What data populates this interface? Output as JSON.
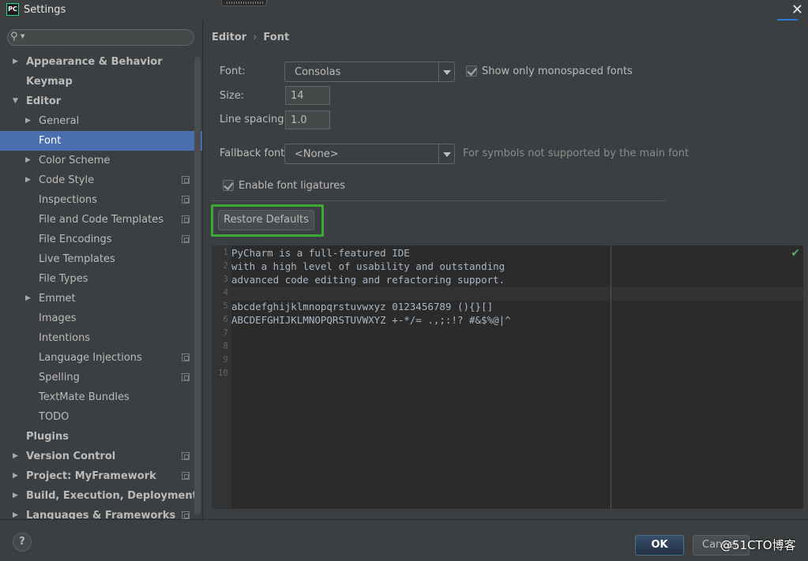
{
  "window": {
    "title": "Settings",
    "app_icon": "PC"
  },
  "search": {
    "placeholder": ""
  },
  "sidebar": {
    "items": [
      {
        "label": "Appearance & Behavior",
        "level": 0,
        "arrow": "right",
        "bold": true,
        "proj": false
      },
      {
        "label": "Keymap",
        "level": 0,
        "arrow": "",
        "bold": true,
        "proj": false
      },
      {
        "label": "Editor",
        "level": 0,
        "arrow": "down",
        "bold": true,
        "proj": false
      },
      {
        "label": "General",
        "level": 1,
        "arrow": "right",
        "bold": false,
        "proj": false
      },
      {
        "label": "Font",
        "level": 1,
        "arrow": "",
        "bold": false,
        "proj": false,
        "selected": true
      },
      {
        "label": "Color Scheme",
        "level": 1,
        "arrow": "right",
        "bold": false,
        "proj": false
      },
      {
        "label": "Code Style",
        "level": 1,
        "arrow": "right",
        "bold": false,
        "proj": true
      },
      {
        "label": "Inspections",
        "level": 1,
        "arrow": "",
        "bold": false,
        "proj": true
      },
      {
        "label": "File and Code Templates",
        "level": 1,
        "arrow": "",
        "bold": false,
        "proj": true
      },
      {
        "label": "File Encodings",
        "level": 1,
        "arrow": "",
        "bold": false,
        "proj": true
      },
      {
        "label": "Live Templates",
        "level": 1,
        "arrow": "",
        "bold": false,
        "proj": false
      },
      {
        "label": "File Types",
        "level": 1,
        "arrow": "",
        "bold": false,
        "proj": false
      },
      {
        "label": "Emmet",
        "level": 1,
        "arrow": "right",
        "bold": false,
        "proj": false
      },
      {
        "label": "Images",
        "level": 1,
        "arrow": "",
        "bold": false,
        "proj": false
      },
      {
        "label": "Intentions",
        "level": 1,
        "arrow": "",
        "bold": false,
        "proj": false
      },
      {
        "label": "Language Injections",
        "level": 1,
        "arrow": "",
        "bold": false,
        "proj": true
      },
      {
        "label": "Spelling",
        "level": 1,
        "arrow": "",
        "bold": false,
        "proj": true
      },
      {
        "label": "TextMate Bundles",
        "level": 1,
        "arrow": "",
        "bold": false,
        "proj": false
      },
      {
        "label": "TODO",
        "level": 1,
        "arrow": "",
        "bold": false,
        "proj": false
      },
      {
        "label": "Plugins",
        "level": 0,
        "arrow": "",
        "bold": true,
        "proj": false
      },
      {
        "label": "Version Control",
        "level": 0,
        "arrow": "right",
        "bold": true,
        "proj": true
      },
      {
        "label": "Project: MyFramework",
        "level": 0,
        "arrow": "right",
        "bold": true,
        "proj": true
      },
      {
        "label": "Build, Execution, Deployment",
        "level": 0,
        "arrow": "right",
        "bold": true,
        "proj": false
      },
      {
        "label": "Languages & Frameworks",
        "level": 0,
        "arrow": "right",
        "bold": true,
        "proj": true
      }
    ]
  },
  "breadcrumb": {
    "parent": "Editor",
    "separator": "›",
    "current": "Font"
  },
  "font_settings": {
    "font_label": "Font:",
    "font_value": "Consolas",
    "monospaced_label": "Show only monospaced fonts",
    "monospaced_checked": true,
    "size_label": "Size:",
    "size_value": "14",
    "line_spacing_label": "Line spacing:",
    "line_spacing_value": "1.0",
    "fallback_label": "Fallback font:",
    "fallback_value": "<None>",
    "fallback_hint": "For symbols not supported by the main font",
    "ligatures_label": "Enable font ligatures",
    "ligatures_checked": true,
    "restore_label": "Restore Defaults"
  },
  "preview": {
    "lines": [
      {
        "no": "1",
        "text": "PyCharm is a full-featured IDE"
      },
      {
        "no": "2",
        "text": "with a high level of usability and outstanding"
      },
      {
        "no": "3",
        "text": "advanced code editing and refactoring support."
      },
      {
        "no": "4",
        "text": ""
      },
      {
        "no": "5",
        "text": "abcdefghijklmnopqrstuvwxyz 0123456789 (){}[]"
      },
      {
        "no": "6",
        "text": "ABCDEFGHIJKLMNOPQRSTUVWXYZ +-*/= .,;:!? #&$%@|^"
      },
      {
        "no": "7",
        "text": ""
      },
      {
        "no": "8",
        "text": ""
      },
      {
        "no": "9",
        "text": ""
      },
      {
        "no": "10",
        "text": ""
      }
    ],
    "status_icon": "check-icon"
  },
  "footer": {
    "help_label": "?",
    "ok_label": "OK",
    "cancel_label": "Cancel",
    "watermark": "@51CTO博客"
  },
  "colors": {
    "background": "#3c3f41",
    "selection": "#4b6eaf",
    "editor_bg": "#2b2b2b",
    "highlight": "#3aaa35"
  }
}
